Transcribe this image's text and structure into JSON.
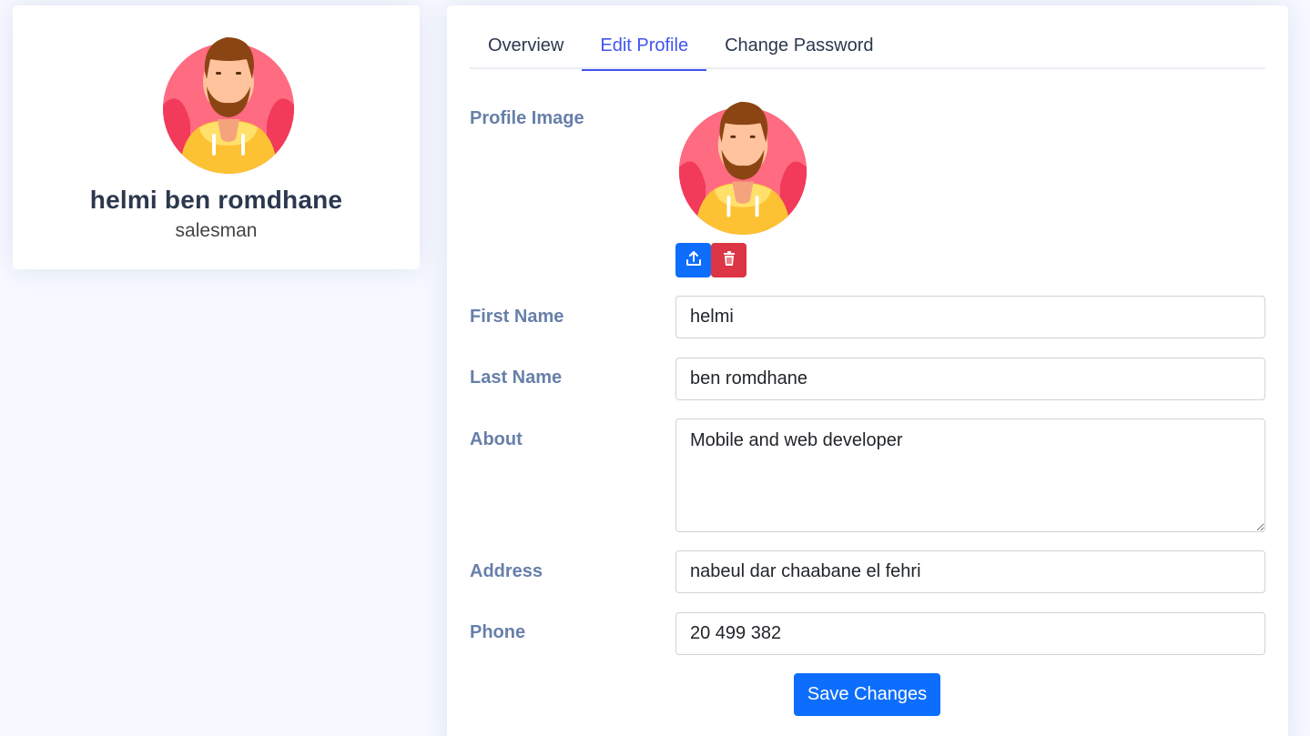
{
  "profile_card": {
    "name": "helmi ben romdhane",
    "role": "salesman"
  },
  "tabs": [
    {
      "label": "Overview",
      "active": false
    },
    {
      "label": "Edit Profile",
      "active": true
    },
    {
      "label": "Change Password",
      "active": false
    }
  ],
  "form": {
    "profile_image_label": "Profile Image",
    "upload_icon": "upload-icon",
    "delete_icon": "trash-icon",
    "first_name": {
      "label": "First Name",
      "value": "helmi"
    },
    "last_name": {
      "label": "Last Name",
      "value": "ben romdhane"
    },
    "about": {
      "label": "About",
      "value": "Mobile and web developer"
    },
    "address": {
      "label": "Address",
      "value": "nabeul dar chaabane el fehri"
    },
    "phone": {
      "label": "Phone",
      "value": "20 499 382"
    },
    "save_label": "Save Changes"
  },
  "colors": {
    "accent": "#4154f1",
    "primary": "#0d6efd",
    "danger": "#dc3545",
    "label": "#899bbd",
    "background": "#f6f9ff"
  }
}
